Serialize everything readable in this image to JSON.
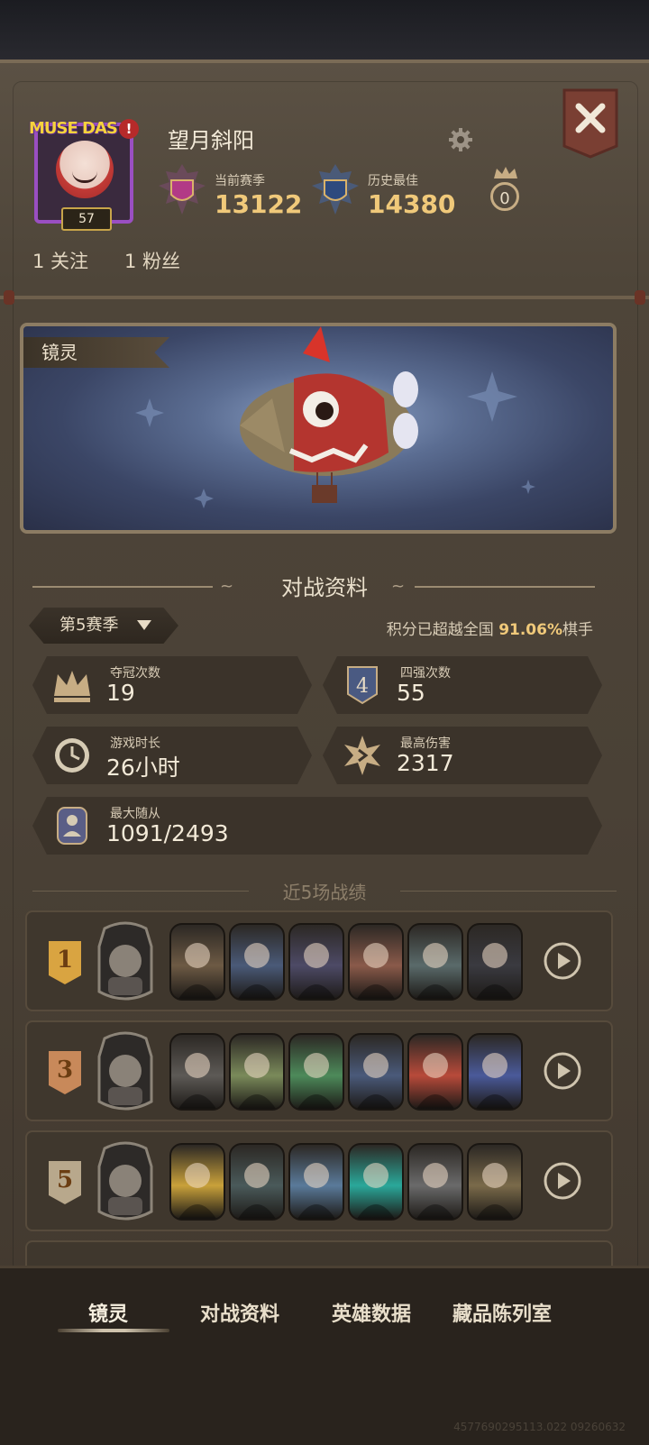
{
  "profile": {
    "name": "望月斜阳",
    "avatar_brand": "MUSE DAS",
    "avatar_alert": "!",
    "level": "57",
    "current_season_label": "当前赛季",
    "current_season_value": "13122",
    "best_label": "历史最佳",
    "best_value": "14380",
    "crown_count": "0",
    "following": "1 关注",
    "followers": "1 粉丝"
  },
  "showcase": {
    "label": "镜灵"
  },
  "battle": {
    "title": "对战资料",
    "season": "第5赛季",
    "rank_note_prefix": "积分已超越全国 ",
    "rank_note_value": "91.06%",
    "rank_note_suffix": "棋手",
    "stats": [
      {
        "label": "夺冠次数",
        "value": "19"
      },
      {
        "label": "四强次数",
        "value": "55"
      },
      {
        "label": "游戏时长",
        "value": "26小时"
      },
      {
        "label": "最高伤害",
        "value": "2317"
      },
      {
        "label": "最大随从",
        "value": "1091/2493"
      }
    ],
    "top4_icon_text": "4"
  },
  "recent": {
    "title": "近5场战绩",
    "matches": [
      {
        "placement": "1",
        "color": "#d9a441",
        "units": [
          "#6d5a44",
          "#4a5a78",
          "#4d4a66",
          "#8a5a4a",
          "#5a6a6a",
          "#3a3a40"
        ]
      },
      {
        "placement": "3",
        "color": "#c8895a",
        "units": [
          "#5d5a56",
          "#7a8a5a",
          "#4d8a5a",
          "#4a5a7a",
          "#b84a3a",
          "#4a5a9a"
        ]
      },
      {
        "placement": "5",
        "color": "#b8a88c",
        "units": [
          "#c9a13a",
          "#4a5a5a",
          "#5a7a9a",
          "#2aa89a",
          "#6a6a6a",
          "#7a6a4a"
        ]
      }
    ]
  },
  "tabs": [
    "镜灵",
    "对战资料",
    "英雄数据",
    "藏品陈列室"
  ],
  "footer_id": "4577690295113.022 09260632",
  "colors": {
    "gold": "#f0c97a",
    "panel": "#4a4136",
    "accent_red": "#b62a2a"
  }
}
